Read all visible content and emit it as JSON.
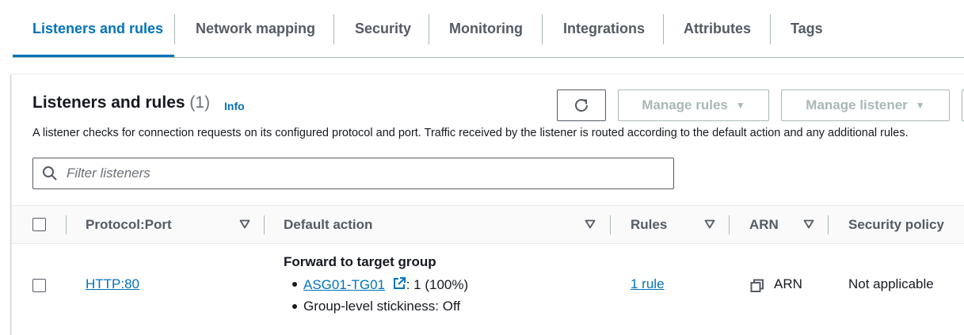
{
  "tabs": [
    {
      "label": "Listeners and rules",
      "active": true
    },
    {
      "label": "Network mapping"
    },
    {
      "label": "Security"
    },
    {
      "label": "Monitoring"
    },
    {
      "label": "Integrations"
    },
    {
      "label": "Attributes"
    },
    {
      "label": "Tags"
    }
  ],
  "panel": {
    "title": "Listeners and rules",
    "count": "(1)",
    "info": "Info",
    "description": "A listener checks for connection requests on its configured protocol and port. Traffic received by the listener is routed according to the default action and any additional rules.",
    "manage_rules_label": "Manage rules",
    "manage_listener_label": "Manage listener",
    "filter_placeholder": "Filter listeners"
  },
  "table": {
    "headers": {
      "protocol_port": "Protocol:Port",
      "default_action": "Default action",
      "rules": "Rules",
      "arn": "ARN",
      "security_policy": "Security policy"
    },
    "rows": [
      {
        "protocol_port": "HTTP:80",
        "action_title": "Forward to target group",
        "target_group": "ASG01-TG01",
        "target_weight": ": 1 (100%)",
        "stickiness": "Group-level stickiness: Off",
        "rules": "1 rule",
        "arn": "ARN",
        "security_policy": "Not applicable"
      }
    ]
  },
  "colors": {
    "accent": "#0073bb",
    "text": "#16191f",
    "muted": "#545b64",
    "disabled": "#aab7b8"
  },
  "icons": [
    "refresh-icon",
    "caret-down-icon",
    "search-icon",
    "sort-icon",
    "external-link-icon",
    "copy-icon"
  ]
}
